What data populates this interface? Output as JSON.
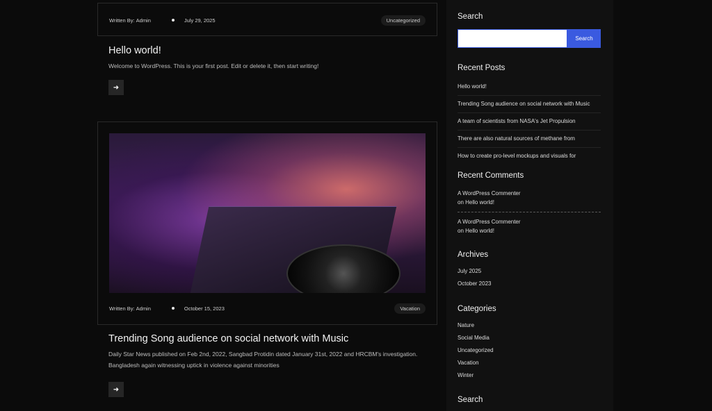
{
  "posts": [
    {
      "author_prefix": "Written By:",
      "author": "Admin",
      "date": "July 29, 2025",
      "category": "Uncategorized",
      "title": "Hello world!",
      "excerpt": "Welcome to WordPress. This is your first post. Edit or delete it, then start writing!",
      "arrow_icon": "arrow-right-icon"
    },
    {
      "author_prefix": "Written By:",
      "author": "Admin",
      "date": "October 15, 2023",
      "category": "Vacation",
      "title": "Trending Song audience on social network with Music",
      "excerpt_line1": "Daily Star News published on Feb 2nd, 2022, Sangbad Protidin dated January 31st, 2022 and HRCBM's investigation.",
      "excerpt_line2": "Bangladesh again witnessing uptick in violence against minorities",
      "arrow_icon": "arrow-right-icon"
    }
  ],
  "sidebar": {
    "search": {
      "title": "Search",
      "button_label": "Search",
      "input_value": "",
      "accent": "#3a5ae0"
    },
    "recent_posts": {
      "title": "Recent Posts",
      "items": [
        "Hello world!",
        "Trending Song audience on social network with Music",
        "A team of scientists from NASA's Jet Propulsion",
        "There are also natural sources of methane from",
        "How to create pro-level mockups and visuals for"
      ]
    },
    "recent_comments": {
      "title": "Recent Comments",
      "items": [
        {
          "author": "A WordPress Commenter",
          "on": "on",
          "post": "Hello world!"
        },
        {
          "author": "A WordPress Commenter",
          "on": "on",
          "post": "Hello world!"
        }
      ]
    },
    "archives": {
      "title": "Archives",
      "items": [
        "July 2025",
        "October 2023"
      ]
    },
    "categories": {
      "title": "Categories",
      "items": [
        "Nature",
        "Social Media",
        "Uncategorized",
        "Vacation",
        "Winter"
      ]
    },
    "search_bottom": {
      "title": "Search"
    }
  }
}
